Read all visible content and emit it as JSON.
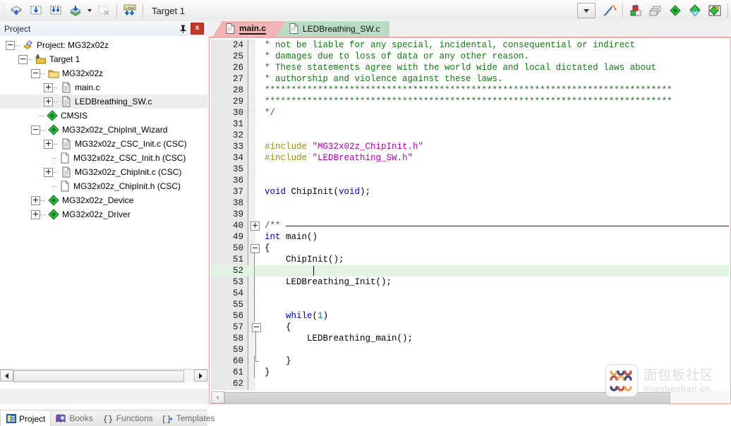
{
  "window": {
    "app": "Keil uVision IDE"
  },
  "toolbar": {
    "icons": [
      {
        "name": "build-icon",
        "title": "Translate"
      },
      {
        "name": "build-target-icon",
        "title": "Build"
      },
      {
        "name": "rebuild-all-icon",
        "title": "Rebuild"
      },
      {
        "name": "batch-build-icon",
        "title": "Batch Build"
      },
      {
        "name": "stop-build-icon",
        "title": "Stop Build"
      },
      {
        "name": "download-icon",
        "title": "Download"
      }
    ],
    "target_value": "Target 1",
    "right_icons": [
      {
        "name": "target-options-icon",
        "title": "Options for Target"
      },
      {
        "name": "manage-project-items-icon",
        "title": "Manage Project Items"
      },
      {
        "name": "multi-project-icon",
        "title": "Multi-Project"
      },
      {
        "name": "pack-installer-icon",
        "title": "Pack Installer"
      },
      {
        "name": "manage-run-time-icon",
        "title": "Manage Run-Time Environment"
      }
    ]
  },
  "project_panel": {
    "title": "Project",
    "pin_label": "",
    "close_label": "x",
    "tree": [
      {
        "level": 0,
        "label": "Project: MG32x02z",
        "toggle": "minus",
        "icon": "project-icon",
        "selected": false
      },
      {
        "level": 1,
        "label": "Target 1",
        "toggle": "minus",
        "icon": "target-icon",
        "selected": false
      },
      {
        "level": 2,
        "label": "MG32x02z",
        "toggle": "minus",
        "icon": "folder-icon",
        "selected": false
      },
      {
        "level": 3,
        "label": "main.c",
        "toggle": "plus",
        "icon": "c-file-icon",
        "selected": false
      },
      {
        "level": 3,
        "label": "LEDBreathing_SW.c",
        "toggle": "plus",
        "icon": "c-file-icon",
        "selected": true
      },
      {
        "level": 2,
        "label": "CMSIS",
        "toggle": "none",
        "icon": "component-icon",
        "selected": false
      },
      {
        "level": 2,
        "label": "MG32x02z_ChipInit_Wizard",
        "toggle": "minus",
        "icon": "component-icon",
        "selected": false
      },
      {
        "level": 3,
        "label": "MG32x02z_CSC_Init.c (CSC)",
        "toggle": "plus",
        "icon": "c-file-icon",
        "selected": false
      },
      {
        "level": 3,
        "label": "MG32x02z_CSC_Init.h (CSC)",
        "toggle": "none",
        "icon": "h-file-icon",
        "selected": false
      },
      {
        "level": 3,
        "label": "MG32x02z_ChipInit.c (CSC)",
        "toggle": "plus",
        "icon": "c-file-icon",
        "selected": false
      },
      {
        "level": 3,
        "label": "MG32x02z_ChipInit.h (CSC)",
        "toggle": "none",
        "icon": "h-file-icon",
        "selected": false
      },
      {
        "level": 2,
        "label": "MG32x02z_Device",
        "toggle": "plus",
        "icon": "component-icon",
        "selected": false
      },
      {
        "level": 2,
        "label": "MG32x02z_Driver",
        "toggle": "plus",
        "icon": "component-icon",
        "selected": false
      }
    ],
    "bottom_tabs": [
      {
        "label": "Project",
        "icon": "project-tab-icon",
        "active": true
      },
      {
        "label": "Books",
        "icon": "books-tab-icon",
        "active": false
      },
      {
        "label": "Functions",
        "icon": "functions-tab-icon",
        "active": false
      },
      {
        "label": "Templates",
        "icon": "templates-tab-icon",
        "active": false
      }
    ]
  },
  "editor": {
    "tabs": [
      {
        "label": "main.c",
        "active": true
      },
      {
        "label": "LEDBreathing_SW.c",
        "active": false
      }
    ],
    "scroll_left_label": "‹",
    "lines": [
      {
        "n": "24",
        "fold": "none",
        "indent": 0,
        "segs": [
          {
            "t": "* not be liable for any special, incidental, consequential or indirect",
            "c": "c-com"
          }
        ]
      },
      {
        "n": "25",
        "fold": "none",
        "indent": 0,
        "segs": [
          {
            "t": "* damages due to loss of data or any other reason.",
            "c": "c-com"
          }
        ]
      },
      {
        "n": "26",
        "fold": "none",
        "indent": 0,
        "segs": [
          {
            "t": "* These statements agree with the world wide and local dictated laws about",
            "c": "c-com"
          }
        ]
      },
      {
        "n": "27",
        "fold": "none",
        "indent": 0,
        "segs": [
          {
            "t": "* authorship and violence against these laws.",
            "c": "c-com"
          }
        ]
      },
      {
        "n": "28",
        "fold": "none",
        "indent": 0,
        "segs": [
          {
            "t": "*****************************************************************************",
            "c": "c-com"
          }
        ]
      },
      {
        "n": "29",
        "fold": "none",
        "indent": 0,
        "segs": [
          {
            "t": "*****************************************************************************",
            "c": "c-com"
          }
        ]
      },
      {
        "n": "30",
        "fold": "none",
        "indent": 0,
        "segs": [
          {
            "t": "*/",
            "c": "c-com"
          }
        ]
      },
      {
        "n": "31",
        "fold": "none",
        "indent": 0,
        "segs": []
      },
      {
        "n": "32",
        "fold": "none",
        "indent": 0,
        "segs": []
      },
      {
        "n": "33",
        "fold": "none",
        "indent": 0,
        "segs": [
          {
            "t": "#include ",
            "c": "c-pre"
          },
          {
            "t": "\"MG32x02z_ChipInit.h\"",
            "c": "c-str"
          }
        ]
      },
      {
        "n": "34",
        "fold": "none",
        "indent": 0,
        "segs": [
          {
            "t": "#include ",
            "c": "c-pre"
          },
          {
            "t": "\"LEDBreathing_SW.h\"",
            "c": "c-str"
          }
        ]
      },
      {
        "n": "35",
        "fold": "none",
        "indent": 0,
        "segs": []
      },
      {
        "n": "36",
        "fold": "none",
        "indent": 0,
        "segs": []
      },
      {
        "n": "37",
        "fold": "none",
        "indent": 0,
        "segs": [
          {
            "t": "void",
            "c": "c-kw"
          },
          {
            "t": " ChipInit(",
            "c": ""
          },
          {
            "t": "void",
            "c": "c-kw"
          },
          {
            "t": ");",
            "c": ""
          }
        ]
      },
      {
        "n": "38",
        "fold": "none",
        "indent": 0,
        "segs": []
      },
      {
        "n": "39",
        "fold": "none",
        "indent": 0,
        "segs": []
      },
      {
        "n": "40",
        "fold": "plus",
        "indent": 0,
        "rule": true,
        "segs": [
          {
            "t": "/**",
            "c": "c-com"
          }
        ]
      },
      {
        "n": "49",
        "fold": "none",
        "indent": 0,
        "segs": [
          {
            "t": "int",
            "c": "c-kw"
          },
          {
            "t": " main()",
            "c": ""
          }
        ]
      },
      {
        "n": "50",
        "fold": "minus",
        "indent": 0,
        "segs": [
          {
            "t": "{",
            "c": ""
          }
        ]
      },
      {
        "n": "51",
        "fold": "bar",
        "indent": 0,
        "segs": [
          {
            "t": "    ChipInit();",
            "c": ""
          }
        ]
      },
      {
        "n": "52",
        "fold": "bar",
        "indent": 0,
        "current": true,
        "cursor": true,
        "segs": []
      },
      {
        "n": "53",
        "fold": "bar",
        "indent": 0,
        "segs": [
          {
            "t": "    LEDBreathing_Init();",
            "c": ""
          }
        ]
      },
      {
        "n": "54",
        "fold": "bar",
        "indent": 0,
        "segs": []
      },
      {
        "n": "55",
        "fold": "bar",
        "indent": 0,
        "segs": []
      },
      {
        "n": "56",
        "fold": "bar",
        "indent": 0,
        "segs": [
          {
            "t": "    ",
            "c": ""
          },
          {
            "t": "while",
            "c": "c-kw"
          },
          {
            "t": "(",
            "c": ""
          },
          {
            "t": "1",
            "c": "c-num"
          },
          {
            "t": ")",
            "c": ""
          }
        ]
      },
      {
        "n": "57",
        "fold": "minus2",
        "indent": 0,
        "segs": [
          {
            "t": "    {",
            "c": ""
          }
        ]
      },
      {
        "n": "58",
        "fold": "bar2",
        "indent": 0,
        "segs": [
          {
            "t": "        LEDBreathing_main();",
            "c": ""
          }
        ]
      },
      {
        "n": "59",
        "fold": "bar2",
        "indent": 0,
        "segs": []
      },
      {
        "n": "60",
        "fold": "endtick2",
        "indent": 0,
        "segs": [
          {
            "t": "    }",
            "c": ""
          }
        ]
      },
      {
        "n": "61",
        "fold": "bar",
        "indent": 0,
        "segs": [
          {
            "t": "}",
            "c": ""
          }
        ]
      },
      {
        "n": "62",
        "fold": "none",
        "indent": 0,
        "segs": []
      }
    ]
  },
  "watermark": {
    "cn": "面包板社区",
    "en": "mianbaoban.cn"
  },
  "colors": {
    "active_tab": "#f2b3b3",
    "inactive_tab": "#b8dcc4",
    "comment": "#117711",
    "preprocessor": "#9a8a15",
    "string": "#b000b0",
    "keyword": "#0000d0",
    "number": "#0b7f8f",
    "current_line": "#dff4e3",
    "frame": "#f0a8a8"
  }
}
